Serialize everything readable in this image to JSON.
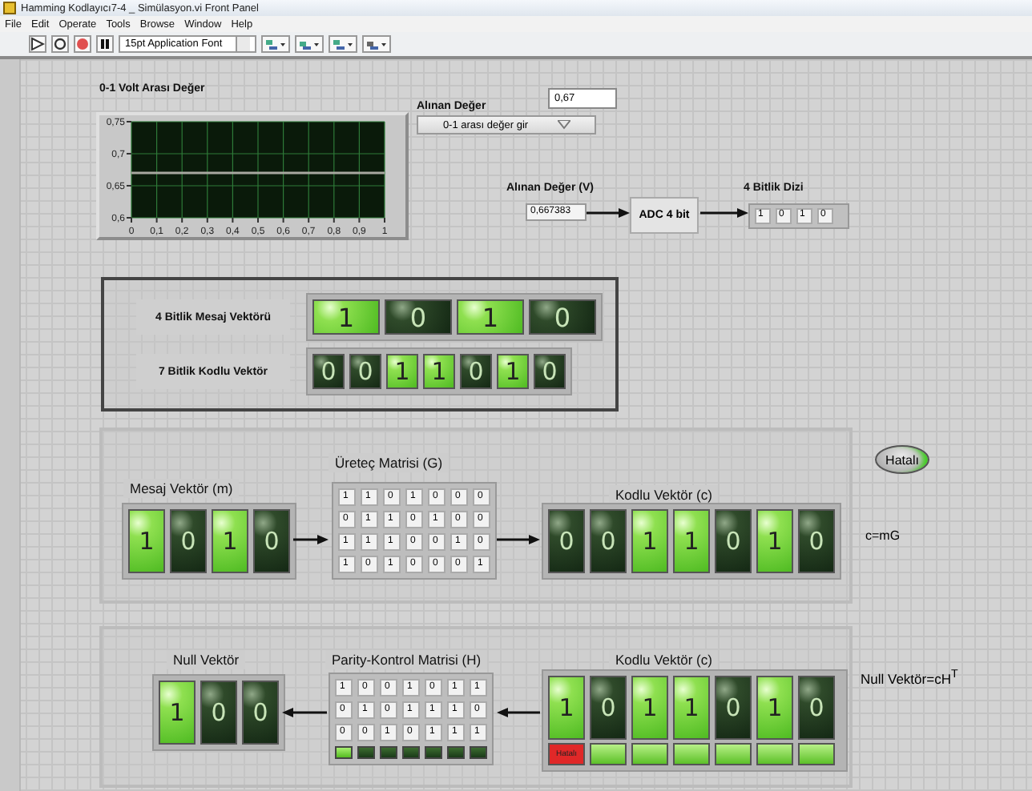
{
  "window": {
    "title": "Hamming Kodlayıcı7-4 _ Simülasyon.vi Front Panel"
  },
  "menu": [
    "File",
    "Edit",
    "Operate",
    "Tools",
    "Browse",
    "Window",
    "Help"
  ],
  "toolbar": {
    "font": "15pt Application Font"
  },
  "chart": {
    "label": "0-1 Volt Arası Değer",
    "chart_data": {
      "type": "line",
      "x": [
        0,
        1
      ],
      "grid": true,
      "series": [
        {
          "color": "#a8a8a0",
          "values": [
            0.67,
            0.67
          ]
        }
      ],
      "xlim": [
        0,
        1
      ],
      "ylim": [
        0.6,
        0.75
      ],
      "xticks": [
        {
          "value": 0,
          "label": "0"
        },
        {
          "value": 0.1,
          "label": "0,1"
        },
        {
          "value": 0.2,
          "label": "0,2"
        },
        {
          "value": 0.3,
          "label": "0,3"
        },
        {
          "value": 0.4,
          "label": "0,4"
        },
        {
          "value": 0.5,
          "label": "0,5"
        },
        {
          "value": 0.6,
          "label": "0,6"
        },
        {
          "value": 0.7,
          "label": "0,7"
        },
        {
          "value": 0.8,
          "label": "0,8"
        },
        {
          "value": 0.9,
          "label": "0,9"
        },
        {
          "value": 1,
          "label": "1"
        }
      ],
      "yticks": [
        {
          "value": 0.6,
          "label": "0,6"
        },
        {
          "value": 0.65,
          "label": "0,65"
        },
        {
          "value": 0.7,
          "label": "0,7"
        },
        {
          "value": 0.75,
          "label": "0,75"
        }
      ]
    }
  },
  "input": {
    "label": "Alınan Değer",
    "value": "0,67"
  },
  "dropdown": {
    "value": "0-1 arası değer gir"
  },
  "adc": {
    "input_label": "Alınan Değer (V)",
    "input_value": "0,667383",
    "block": "ADC 4 bit",
    "output_label": "4 Bitlik Dizi",
    "output": [
      "1",
      "0",
      "1",
      "0"
    ]
  },
  "cluster": [
    {
      "label": "4 Bitlik Mesaj Vektörü",
      "leds": [
        {
          "text": "1",
          "on": true
        },
        {
          "text": "0",
          "on": false
        },
        {
          "text": "1",
          "on": true
        },
        {
          "text": "0",
          "on": false
        }
      ]
    },
    {
      "label": "7 Bitlik Kodlu Vektör",
      "leds": [
        {
          "text": "0",
          "on": false
        },
        {
          "text": "0",
          "on": false
        },
        {
          "text": "1",
          "on": true
        },
        {
          "text": "1",
          "on": true
        },
        {
          "text": "0",
          "on": false
        },
        {
          "text": "1",
          "on": true
        },
        {
          "text": "0",
          "on": false
        }
      ]
    }
  ],
  "encoder": {
    "message_label": "Mesaj Vektör (m)",
    "message": [
      {
        "text": "1",
        "on": true
      },
      {
        "text": "0",
        "on": false
      },
      {
        "text": "1",
        "on": true
      },
      {
        "text": "0",
        "on": false
      }
    ],
    "matrix_label": "Üreteç Matrisi (G)",
    "matrix": [
      [
        "1",
        "1",
        "0",
        "1",
        "0",
        "0",
        "0"
      ],
      [
        "0",
        "1",
        "1",
        "0",
        "1",
        "0",
        "0"
      ],
      [
        "1",
        "1",
        "1",
        "0",
        "0",
        "1",
        "0"
      ],
      [
        "1",
        "0",
        "1",
        "0",
        "0",
        "0",
        "1"
      ]
    ],
    "code_label": "Kodlu Vektör (c)",
    "code": [
      {
        "text": "0",
        "on": false
      },
      {
        "text": "0",
        "on": false
      },
      {
        "text": "1",
        "on": true
      },
      {
        "text": "1",
        "on": true
      },
      {
        "text": "0",
        "on": false
      },
      {
        "text": "1",
        "on": true
      },
      {
        "text": "0",
        "on": false
      }
    ]
  },
  "error_button": {
    "label": "Hatalı",
    "lit": true
  },
  "encoder_formula": "c=mG",
  "decoder": {
    "null_label": "Null Vektör",
    "null": [
      {
        "text": "1",
        "on": true
      },
      {
        "text": "0",
        "on": false
      },
      {
        "text": "0",
        "on": false
      }
    ],
    "matrix_label": "Parity-Kontrol Matrisi (H)",
    "matrix": [
      [
        "1",
        "0",
        "0",
        "1",
        "0",
        "1",
        "1"
      ],
      [
        "0",
        "1",
        "0",
        "1",
        "1",
        "1",
        "0"
      ],
      [
        "0",
        "0",
        "1",
        "0",
        "1",
        "1",
        "1"
      ]
    ],
    "matrix_leds": [
      {
        "on": true
      },
      {
        "on": false
      },
      {
        "on": false
      },
      {
        "on": false
      },
      {
        "on": false
      },
      {
        "on": false
      },
      {
        "on": false
      }
    ],
    "code_label": "Kodlu Vektör (c)",
    "code": [
      {
        "text": "1",
        "on": true
      },
      {
        "text": "0",
        "on": false
      },
      {
        "text": "1",
        "on": true
      },
      {
        "text": "1",
        "on": true
      },
      {
        "text": "0",
        "on": false
      },
      {
        "text": "1",
        "on": true
      },
      {
        "text": "0",
        "on": false
      }
    ],
    "error_switches": [
      {
        "error": true,
        "label": "Hatalı"
      },
      {
        "error": false
      },
      {
        "error": false
      },
      {
        "error": false
      },
      {
        "error": false
      },
      {
        "error": false
      },
      {
        "error": false
      }
    ]
  },
  "decoder_formula": "Null Vektör=cH$^{T}$"
}
